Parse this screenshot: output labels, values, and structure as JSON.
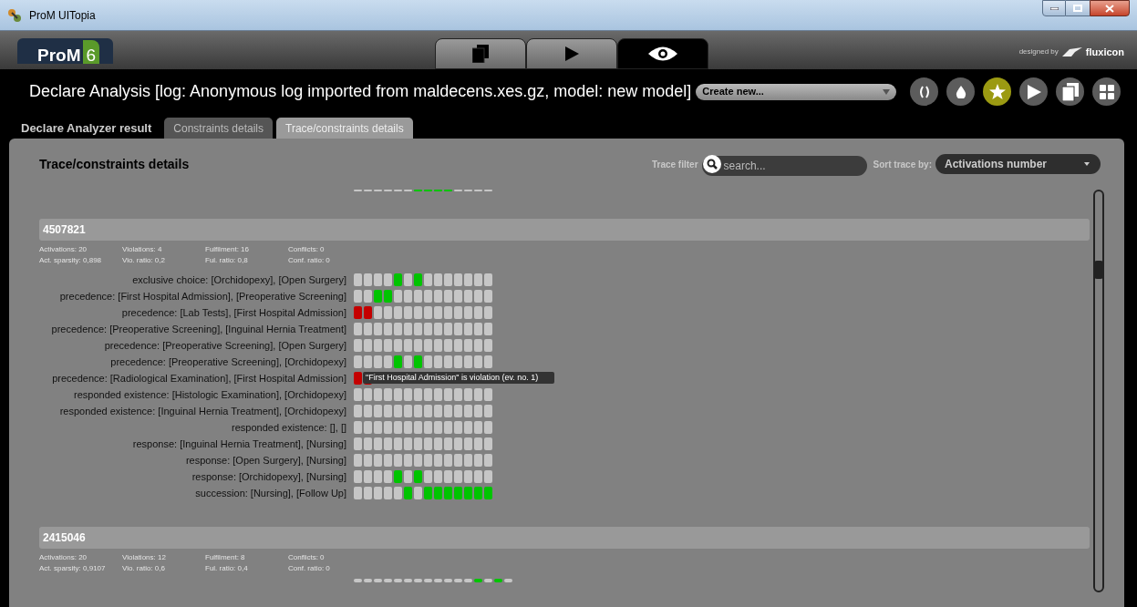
{
  "window": {
    "title": "ProM UITopia"
  },
  "logo": {
    "name": "ProM",
    "version": "6"
  },
  "perspective_tabs": [
    {
      "kind": "files",
      "selected": false
    },
    {
      "kind": "play",
      "selected": false
    },
    {
      "kind": "eye",
      "selected": true
    }
  ],
  "branding": {
    "prefix": "designed by",
    "name": "fluxicon"
  },
  "view_title": "Declare Analysis [log: Anonymous log imported from maldecens.xes.gz, model: new model]",
  "create_dropdown": {
    "value": "Create new..."
  },
  "action_buttons": [
    {
      "kind": "brackets",
      "selected": false
    },
    {
      "kind": "drop",
      "selected": false
    },
    {
      "kind": "star",
      "selected": true
    },
    {
      "kind": "play",
      "selected": false
    },
    {
      "kind": "files",
      "selected": false
    },
    {
      "kind": "grid",
      "selected": false
    }
  ],
  "result_label": "Declare Analyzer result",
  "tabs": [
    {
      "label": "Constraints details",
      "selected": false
    },
    {
      "label": "Trace/constraints details",
      "selected": true
    }
  ],
  "panel": {
    "title": "Trace/constraints details",
    "trace_filter": {
      "label": "Trace filter",
      "placeholder": "search..."
    },
    "sort": {
      "label": "Sort trace by:",
      "value": "Activations number"
    },
    "scrolled_strip": [
      {
        "kind": "none"
      },
      {
        "kind": "none"
      },
      {
        "kind": "none"
      },
      {
        "kind": "none"
      },
      {
        "kind": "none"
      },
      {
        "kind": "none"
      },
      {
        "kind": "fulfilled"
      },
      {
        "kind": "fulfilled"
      },
      {
        "kind": "fulfilled"
      },
      {
        "kind": "fulfilled"
      },
      {
        "kind": "none"
      },
      {
        "kind": "none"
      },
      {
        "kind": "none"
      },
      {
        "kind": "none"
      }
    ],
    "traces": [
      {
        "id": "4507821",
        "stats": [
          "Activations: 20",
          "Violations: 4",
          "Fulfilment: 16",
          "Conflicts: 0",
          "Act. sparsity: 0,898",
          "Vio. ratio: 0,2",
          "Ful. ratio: 0,8",
          "Conf. ratio: 0"
        ],
        "constraints": [
          {
            "label": "exclusive choice: [Orchidopexy], [Open Surgery]",
            "cells": [
              {
                "kind": "none"
              },
              {
                "kind": "none"
              },
              {
                "kind": "none"
              },
              {
                "kind": "none"
              },
              {
                "kind": "fulfilled"
              },
              {
                "kind": "none"
              },
              {
                "kind": "fulfilled"
              },
              {
                "kind": "none"
              },
              {
                "kind": "none"
              },
              {
                "kind": "none"
              },
              {
                "kind": "none"
              },
              {
                "kind": "none"
              },
              {
                "kind": "none"
              },
              {
                "kind": "none"
              }
            ]
          },
          {
            "label": "precedence: [First Hospital Admission], [Preoperative Screening]",
            "cells": [
              {
                "kind": "none"
              },
              {
                "kind": "none"
              },
              {
                "kind": "fulfilled"
              },
              {
                "kind": "fulfilled"
              },
              {
                "kind": "none"
              },
              {
                "kind": "none"
              },
              {
                "kind": "none"
              },
              {
                "kind": "none"
              },
              {
                "kind": "none"
              },
              {
                "kind": "none"
              },
              {
                "kind": "none"
              },
              {
                "kind": "none"
              },
              {
                "kind": "none"
              },
              {
                "kind": "none"
              }
            ]
          },
          {
            "label": "precedence: [Lab Tests], [First Hospital Admission]",
            "cells": [
              {
                "kind": "violated"
              },
              {
                "kind": "violated"
              },
              {
                "kind": "none"
              },
              {
                "kind": "none"
              },
              {
                "kind": "none"
              },
              {
                "kind": "none"
              },
              {
                "kind": "none"
              },
              {
                "kind": "none"
              },
              {
                "kind": "none"
              },
              {
                "kind": "none"
              },
              {
                "kind": "none"
              },
              {
                "kind": "none"
              },
              {
                "kind": "none"
              },
              {
                "kind": "none"
              }
            ]
          },
          {
            "label": "precedence: [Preoperative Screening], [Inguinal Hernia Treatment]",
            "cells": [
              {
                "kind": "none"
              },
              {
                "kind": "none"
              },
              {
                "kind": "none"
              },
              {
                "kind": "none"
              },
              {
                "kind": "none"
              },
              {
                "kind": "none"
              },
              {
                "kind": "none"
              },
              {
                "kind": "none"
              },
              {
                "kind": "none"
              },
              {
                "kind": "none"
              },
              {
                "kind": "none"
              },
              {
                "kind": "none"
              },
              {
                "kind": "none"
              },
              {
                "kind": "none"
              }
            ]
          },
          {
            "label": "precedence: [Preoperative Screening], [Open Surgery]",
            "cells": [
              {
                "kind": "none"
              },
              {
                "kind": "none"
              },
              {
                "kind": "none"
              },
              {
                "kind": "none"
              },
              {
                "kind": "none"
              },
              {
                "kind": "none"
              },
              {
                "kind": "none"
              },
              {
                "kind": "none"
              },
              {
                "kind": "none"
              },
              {
                "kind": "none"
              },
              {
                "kind": "none"
              },
              {
                "kind": "none"
              },
              {
                "kind": "none"
              },
              {
                "kind": "none"
              }
            ]
          },
          {
            "label": "precedence: [Preoperative Screening], [Orchidopexy]",
            "cells": [
              {
                "kind": "none"
              },
              {
                "kind": "none"
              },
              {
                "kind": "none"
              },
              {
                "kind": "none"
              },
              {
                "kind": "fulfilled"
              },
              {
                "kind": "none"
              },
              {
                "kind": "fulfilled"
              },
              {
                "kind": "none"
              },
              {
                "kind": "none"
              },
              {
                "kind": "none"
              },
              {
                "kind": "none"
              },
              {
                "kind": "none"
              },
              {
                "kind": "none"
              },
              {
                "kind": "none"
              }
            ]
          },
          {
            "label": "precedence: [Radiological Examination], [First Hospital Admission]",
            "cells": [
              {
                "kind": "violated"
              },
              {
                "kind": "violated"
              }
            ],
            "tooltip": "\"First Hospital Admission\" is violation (ev. no. 1)"
          },
          {
            "label": "responded existence: [Histologic Examination], [Orchidopexy]",
            "cells": [
              {
                "kind": "none"
              },
              {
                "kind": "none"
              },
              {
                "kind": "none"
              },
              {
                "kind": "none"
              },
              {
                "kind": "none"
              },
              {
                "kind": "none"
              },
              {
                "kind": "none"
              },
              {
                "kind": "none"
              },
              {
                "kind": "none"
              },
              {
                "kind": "none"
              },
              {
                "kind": "none"
              },
              {
                "kind": "none"
              },
              {
                "kind": "none"
              },
              {
                "kind": "none"
              }
            ]
          },
          {
            "label": "responded existence: [Inguinal Hernia Treatment], [Orchidopexy]",
            "cells": [
              {
                "kind": "none"
              },
              {
                "kind": "none"
              },
              {
                "kind": "none"
              },
              {
                "kind": "none"
              },
              {
                "kind": "none"
              },
              {
                "kind": "none"
              },
              {
                "kind": "none"
              },
              {
                "kind": "none"
              },
              {
                "kind": "none"
              },
              {
                "kind": "none"
              },
              {
                "kind": "none"
              },
              {
                "kind": "none"
              },
              {
                "kind": "none"
              },
              {
                "kind": "none"
              }
            ]
          },
          {
            "label": "responded existence: [], []",
            "cells": [
              {
                "kind": "none"
              },
              {
                "kind": "none"
              },
              {
                "kind": "none"
              },
              {
                "kind": "none"
              },
              {
                "kind": "none"
              },
              {
                "kind": "none"
              },
              {
                "kind": "none"
              },
              {
                "kind": "none"
              },
              {
                "kind": "none"
              },
              {
                "kind": "none"
              },
              {
                "kind": "none"
              },
              {
                "kind": "none"
              },
              {
                "kind": "none"
              },
              {
                "kind": "none"
              }
            ]
          },
          {
            "label": "response: [Inguinal Hernia Treatment], [Nursing]",
            "cells": [
              {
                "kind": "none"
              },
              {
                "kind": "none"
              },
              {
                "kind": "none"
              },
              {
                "kind": "none"
              },
              {
                "kind": "none"
              },
              {
                "kind": "none"
              },
              {
                "kind": "none"
              },
              {
                "kind": "none"
              },
              {
                "kind": "none"
              },
              {
                "kind": "none"
              },
              {
                "kind": "none"
              },
              {
                "kind": "none"
              },
              {
                "kind": "none"
              },
              {
                "kind": "none"
              }
            ]
          },
          {
            "label": "response: [Open Surgery], [Nursing]",
            "cells": [
              {
                "kind": "none"
              },
              {
                "kind": "none"
              },
              {
                "kind": "none"
              },
              {
                "kind": "none"
              },
              {
                "kind": "none"
              },
              {
                "kind": "none"
              },
              {
                "kind": "none"
              },
              {
                "kind": "none"
              },
              {
                "kind": "none"
              },
              {
                "kind": "none"
              },
              {
                "kind": "none"
              },
              {
                "kind": "none"
              },
              {
                "kind": "none"
              },
              {
                "kind": "none"
              }
            ]
          },
          {
            "label": "response: [Orchidopexy], [Nursing]",
            "cells": [
              {
                "kind": "none"
              },
              {
                "kind": "none"
              },
              {
                "kind": "none"
              },
              {
                "kind": "none"
              },
              {
                "kind": "fulfilled"
              },
              {
                "kind": "none"
              },
              {
                "kind": "fulfilled"
              },
              {
                "kind": "none"
              },
              {
                "kind": "none"
              },
              {
                "kind": "none"
              },
              {
                "kind": "none"
              },
              {
                "kind": "none"
              },
              {
                "kind": "none"
              },
              {
                "kind": "none"
              }
            ]
          },
          {
            "label": "succession: [Nursing], [Follow Up]",
            "cells": [
              {
                "kind": "none"
              },
              {
                "kind": "none"
              },
              {
                "kind": "none"
              },
              {
                "kind": "none"
              },
              {
                "kind": "none"
              },
              {
                "kind": "fulfilled"
              },
              {
                "kind": "none"
              },
              {
                "kind": "fulfilled"
              },
              {
                "kind": "fulfilled"
              },
              {
                "kind": "fulfilled"
              },
              {
                "kind": "fulfilled"
              },
              {
                "kind": "fulfilled"
              },
              {
                "kind": "fulfilled"
              },
              {
                "kind": "fulfilled"
              }
            ]
          }
        ]
      },
      {
        "id": "2415046",
        "stats": [
          "Activations: 20",
          "Violations: 12",
          "Fulfilment: 8",
          "Conflicts: 0",
          "Act. sparsity: 0,9107",
          "Vio. ratio: 0,6",
          "Ful. ratio: 0,4",
          "Conf. ratio: 0"
        ],
        "preview_strip": [
          {
            "kind": "none"
          },
          {
            "kind": "none"
          },
          {
            "kind": "none"
          },
          {
            "kind": "none"
          },
          {
            "kind": "none"
          },
          {
            "kind": "none"
          },
          {
            "kind": "none"
          },
          {
            "kind": "none"
          },
          {
            "kind": "none"
          },
          {
            "kind": "none"
          },
          {
            "kind": "none"
          },
          {
            "kind": "none"
          },
          {
            "kind": "fulfilled"
          },
          {
            "kind": "none"
          },
          {
            "kind": "fulfilled"
          },
          {
            "kind": "none"
          }
        ]
      }
    ]
  }
}
